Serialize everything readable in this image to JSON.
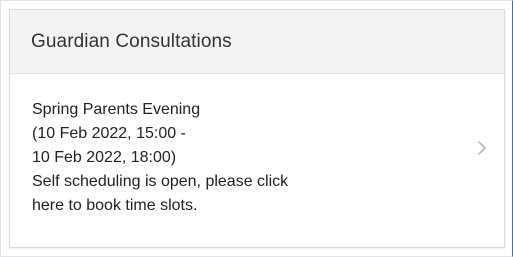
{
  "card": {
    "title": "Guardian Consultations",
    "event_lines": [
      "Spring Parents Evening",
      "(10 Feb 2022, 15:00 -",
      "10 Feb 2022, 18:00)",
      "Self scheduling is open, please click",
      "here to book time slots."
    ],
    "chevron_icon": "chevron-right-icon"
  },
  "colors": {
    "header_background": "#f3f3f3",
    "chevron": "#b8b8b8"
  }
}
